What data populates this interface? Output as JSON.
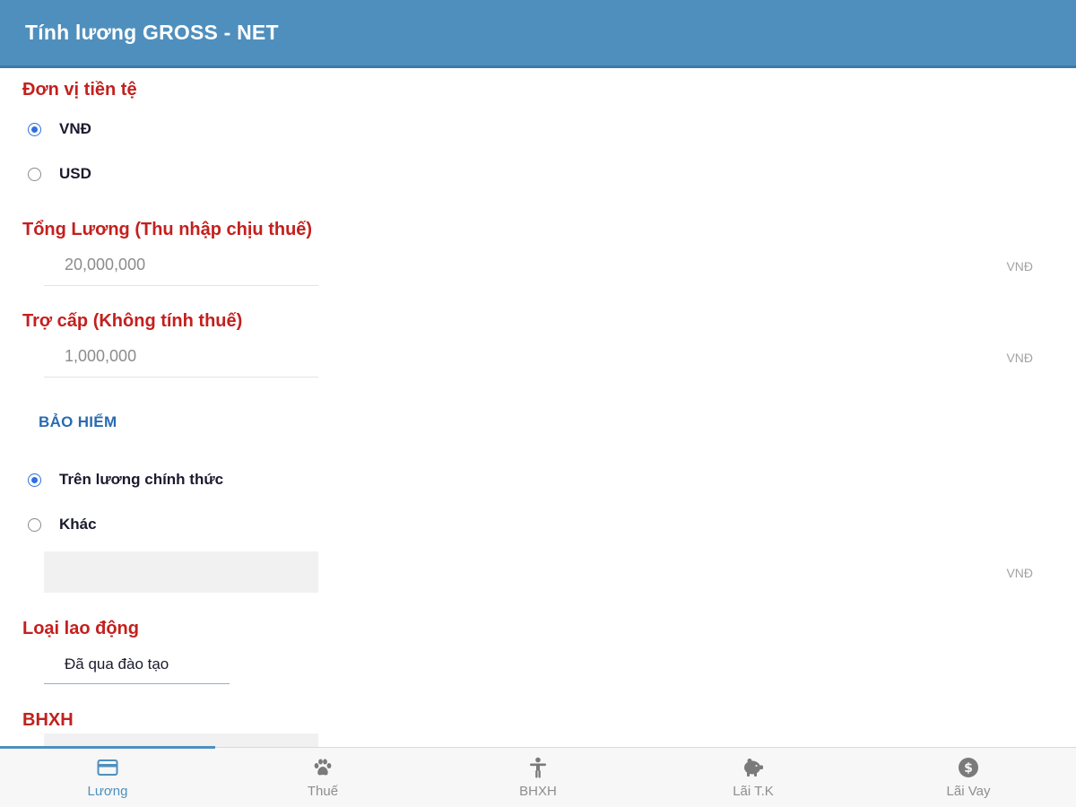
{
  "header": {
    "title": "Tính lương GROSS - NET"
  },
  "currency": {
    "title": "Đơn vị tiền tệ",
    "options": [
      {
        "label": "VNĐ",
        "selected": true
      },
      {
        "label": "USD",
        "selected": false
      }
    ]
  },
  "gross": {
    "title": "Tổng Lương (Thu nhập chịu thuế)",
    "value": "20,000,000",
    "unit": "VNĐ"
  },
  "allowance": {
    "title": "Trợ cấp (Không tính thuế)",
    "value": "1,000,000",
    "unit": "VNĐ"
  },
  "insurance": {
    "label": "BẢO HIỂM",
    "options": [
      {
        "label": "Trên lương chính thức",
        "selected": true
      },
      {
        "label": "Khác",
        "selected": false
      }
    ],
    "other_value": "",
    "unit": "VNĐ"
  },
  "labor_type": {
    "title": "Loại lao động",
    "value": "Đã qua đào tạo"
  },
  "bhxh": {
    "title": "BHXH"
  },
  "tabs": [
    {
      "label": "Lương",
      "icon": "card-icon",
      "active": true
    },
    {
      "label": "Thuế",
      "icon": "paw-icon",
      "active": false
    },
    {
      "label": "BHXH",
      "icon": "person-icon",
      "active": false
    },
    {
      "label": "Lãi T.K",
      "icon": "piggy-bank-icon",
      "active": false
    },
    {
      "label": "Lãi Vay",
      "icon": "dollar-coin-icon",
      "active": false
    }
  ],
  "colors": {
    "header": "#4f8fbd",
    "section_title": "#c3201e",
    "link": "#2a6bb0",
    "radio_active": "#2f6fe0"
  }
}
